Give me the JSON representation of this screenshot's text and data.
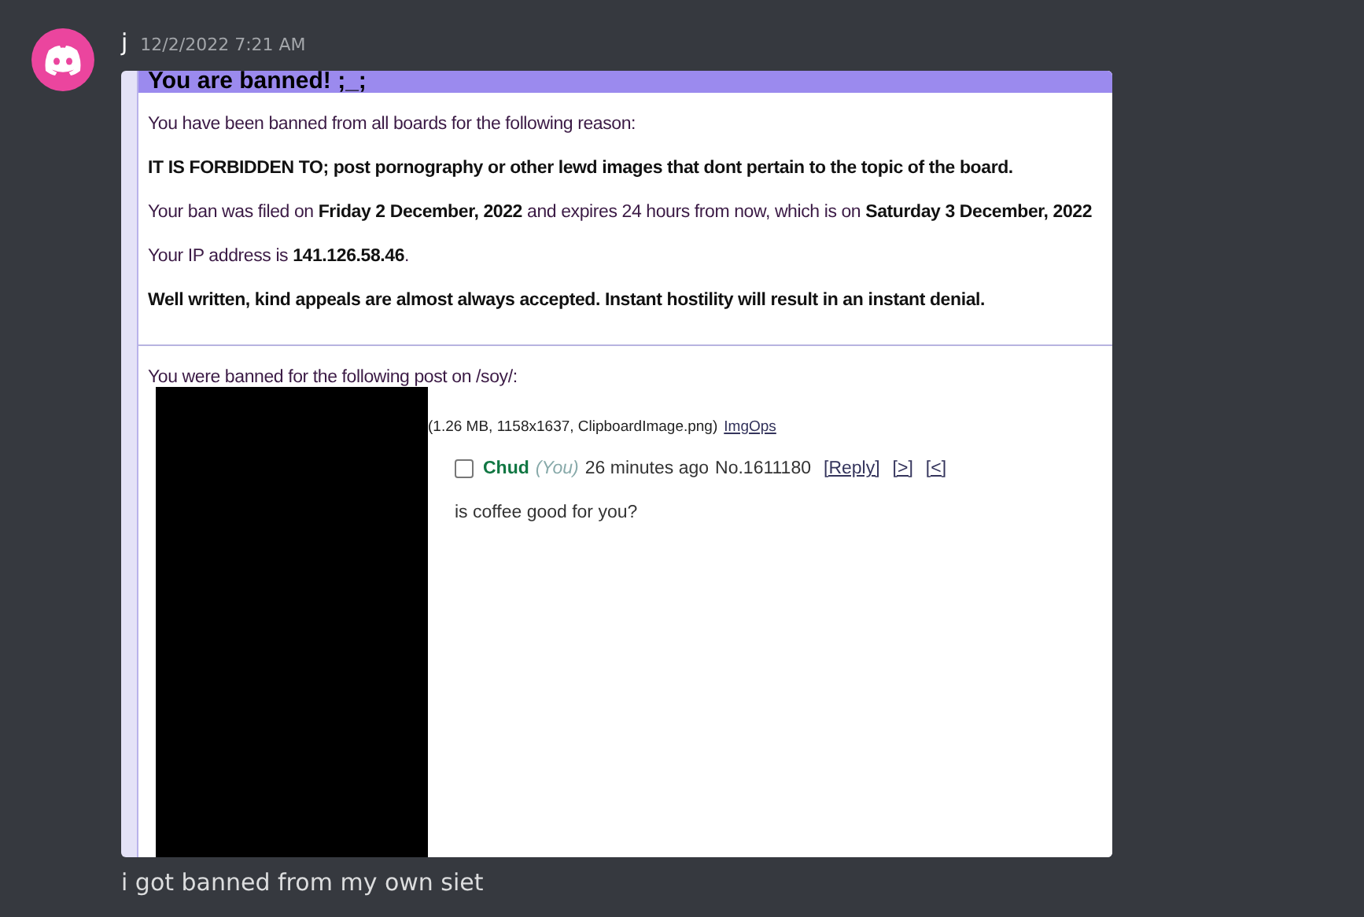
{
  "message": {
    "author": "j",
    "timestamp": "12/2/2022 7:21 AM",
    "text": "i got banned from my own siet"
  },
  "ban_page": {
    "title": "You are banned! ;_;",
    "paragraphs": [
      {
        "kind": "plain",
        "text": "You have been banned from all boards for the following reason:"
      },
      {
        "kind": "strong",
        "text": "IT IS FORBIDDEN TO; post pornography or other lewd images that dont pertain to the topic of the board."
      },
      {
        "kind": "plain",
        "text": "Your ban was filed on **Friday 2 December, 2022** and expires 24 hours from now, which is on **Saturday 3 December, 2022**"
      },
      {
        "kind": "plain",
        "text": "Your IP address is **141.126.58.46**."
      },
      {
        "kind": "strong",
        "text": "Well written, kind appeals are almost always accepted. Instant hostility will result in an instant denial."
      }
    ],
    "post_intro": "You were banned for the following post on /soy/:",
    "file_info": "(1.26 MB, 1158x1637, ClipboardImage.png)",
    "file_link": "ImgOps",
    "post": {
      "checked": false,
      "name": "Chud",
      "you": "(You)",
      "time": "26 minutes ago",
      "number": "No.1611180",
      "links": [
        "[Reply]",
        "[>]",
        "[<]"
      ],
      "body": "is coffee good for you?"
    }
  }
}
